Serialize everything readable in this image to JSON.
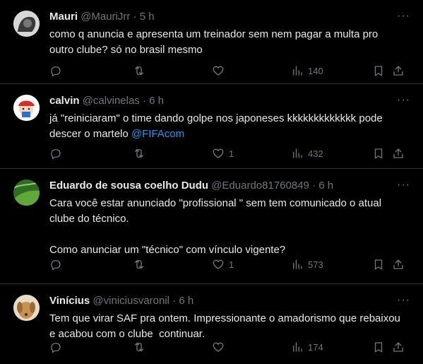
{
  "tweets": [
    {
      "name": "Mauri",
      "handle": "@MauriJrr",
      "dot": "·",
      "time": "5 h",
      "line1": "como q anuncia e apresenta um treinador sem nem pagar a multa pro",
      "line2": "outro clube? só no brasil mesmo",
      "likes": "",
      "views": "140"
    },
    {
      "name": "calvin",
      "handle": "@calvinelas",
      "dot": "·",
      "time": "6 h",
      "line1": "já \"reiniciaram\" o time dando golpe nos japoneses kkkkkkkkkkkkk pode",
      "line2": "descer o martelo",
      "mention": "@FIFAcom",
      "likes": "1",
      "views": "432"
    },
    {
      "name": "Eduardo de sousa coelho Dudu",
      "handle": "@Eduardo81760849",
      "dot": "·",
      "time": "6 h",
      "line1": "Cara você estar anunciado \"profissional \" sem tem comunicado o atual",
      "line2": "clube do técnico.",
      "line3": "Como anunciar um \"técnico\" com vínculo vigente?",
      "likes": "1",
      "views": "573"
    },
    {
      "name": "Vinícius",
      "handle": "@viniciusvaronil",
      "dot": "·",
      "time": "6 h",
      "line1": "Tem que virar SAF pra ontem. Impressionante o amadorismo que rebaixou",
      "line2": "e acabou com o clube  continuar.",
      "likes": "",
      "views": "174"
    }
  ],
  "icons": {
    "more": "more-dots-icon",
    "reply": "reply-icon",
    "retweet": "retweet-icon",
    "like": "heart-icon",
    "views": "views-chart-icon",
    "bookmark": "bookmark-icon",
    "share": "share-icon"
  },
  "colors": {
    "background": "#000000",
    "text": "#e7e9ea",
    "muted": "#71767b",
    "link": "#1d9bf0",
    "divider": "#2f3336"
  }
}
